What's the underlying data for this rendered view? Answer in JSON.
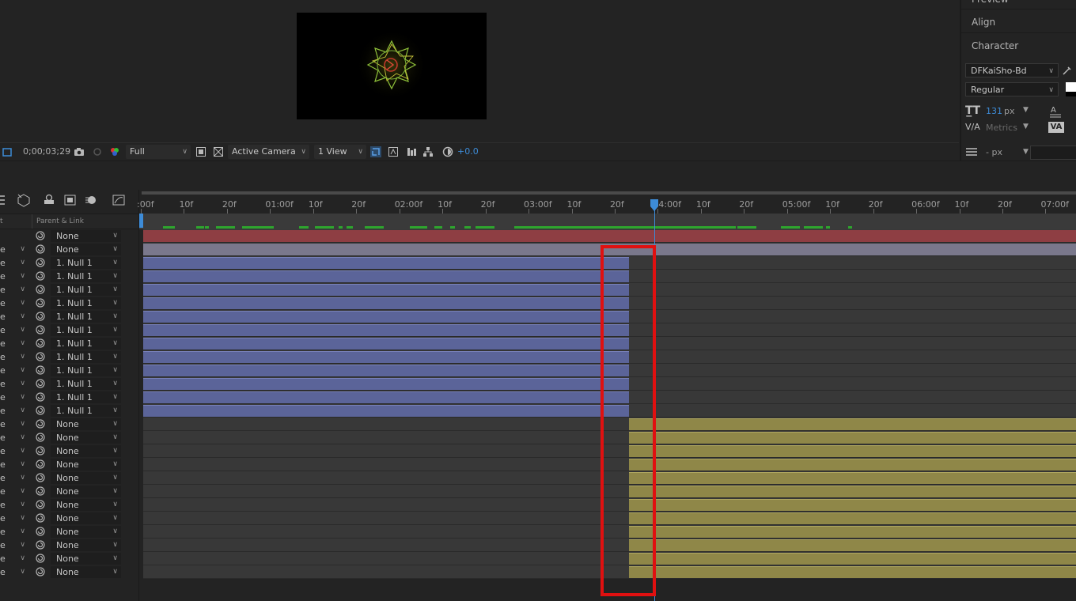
{
  "viewer": {
    "timecode": "0;00;03;29",
    "resolution": "Full",
    "camera": "Active Camera",
    "views": "1 View",
    "exposure": "+0.0",
    "colors": {
      "accent": "#3d8cd8",
      "canvas": "#000000"
    }
  },
  "right_panels": {
    "preview": "Preview",
    "align": "Align",
    "character": "Character",
    "font": "DFKaiSho-Bd",
    "style": "Regular",
    "size_value": "131",
    "size_unit": "px",
    "tracking": "Metrics",
    "leading": "- px"
  },
  "timeline": {
    "col_header_left": "t",
    "col_header_parent": "Parent & Link",
    "ruler_ticks": [
      ":00f",
      "10f",
      "20f",
      "01:00f",
      "10f",
      "20f",
      "02:00f",
      "10f",
      "20f",
      "03:00f",
      "10f",
      "20f",
      "04:00f",
      "10f",
      "20f",
      "05:00f",
      "10f",
      "20f",
      "06:00f",
      "10f",
      "20f",
      "07:00f"
    ],
    "layers": [
      {
        "mode": "",
        "parent": "None",
        "bar": "red"
      },
      {
        "mode": "e",
        "parent": "None",
        "bar": "grey"
      },
      {
        "mode": "e",
        "parent": "1. Null 1",
        "bar": "blue"
      },
      {
        "mode": "e",
        "parent": "1. Null 1",
        "bar": "blue"
      },
      {
        "mode": "e",
        "parent": "1. Null 1",
        "bar": "blue"
      },
      {
        "mode": "e",
        "parent": "1. Null 1",
        "bar": "blue"
      },
      {
        "mode": "e",
        "parent": "1. Null 1",
        "bar": "blue"
      },
      {
        "mode": "e",
        "parent": "1. Null 1",
        "bar": "blue"
      },
      {
        "mode": "e",
        "parent": "1. Null 1",
        "bar": "blue"
      },
      {
        "mode": "e",
        "parent": "1. Null 1",
        "bar": "blue"
      },
      {
        "mode": "e",
        "parent": "1. Null 1",
        "bar": "blue"
      },
      {
        "mode": "e",
        "parent": "1. Null 1",
        "bar": "blue"
      },
      {
        "mode": "e",
        "parent": "1. Null 1",
        "bar": "blue"
      },
      {
        "mode": "e",
        "parent": "1. Null 1",
        "bar": "blue"
      },
      {
        "mode": "e",
        "parent": "None",
        "bar": "gold"
      },
      {
        "mode": "e",
        "parent": "None",
        "bar": "gold"
      },
      {
        "mode": "e",
        "parent": "None",
        "bar": "gold"
      },
      {
        "mode": "e",
        "parent": "None",
        "bar": "gold"
      },
      {
        "mode": "e",
        "parent": "None",
        "bar": "gold"
      },
      {
        "mode": "e",
        "parent": "None",
        "bar": "gold"
      },
      {
        "mode": "e",
        "parent": "None",
        "bar": "gold"
      },
      {
        "mode": "e",
        "parent": "None",
        "bar": "gold"
      },
      {
        "mode": "e",
        "parent": "None",
        "bar": "gold"
      },
      {
        "mode": "e",
        "parent": "None",
        "bar": "gold"
      },
      {
        "mode": "e",
        "parent": "None",
        "bar": "gold"
      },
      {
        "mode": "e",
        "parent": "None",
        "bar": "gold"
      }
    ],
    "colors": {
      "red": "#8e3e43",
      "grey": "#7a788c",
      "blue": "#5b6499",
      "gold": "#8f8748",
      "cache": "#2ea52e",
      "highlight": "#e01010"
    }
  }
}
